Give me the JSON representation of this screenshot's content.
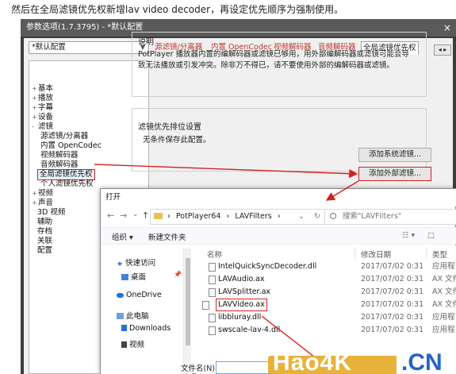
{
  "caption": "然后在全局滤镜优先权新增lav video decoder，再设定优先顺序为强制使用。",
  "settings": {
    "title": "参数选项(1.7.3795) - *默认配置",
    "close_glyph": "×",
    "preset": "*默认配置",
    "tabs": [
      "源滤镜/分离器",
      "内置 OpenCodec",
      "视频解码器",
      "音频解码器",
      "全局滤镜优先权"
    ],
    "tab_scroll": "◂ ▸",
    "tree": [
      {
        "label": "基本",
        "exp": "+"
      },
      {
        "label": "播放",
        "exp": "+"
      },
      {
        "label": "字幕",
        "exp": "+"
      },
      {
        "label": "设备",
        "exp": "+"
      },
      {
        "label": "滤镜",
        "exp": "-"
      },
      {
        "label": "源滤镜/分离器",
        "exp": ""
      },
      {
        "label": "内置 OpenCodec",
        "exp": ""
      },
      {
        "label": "视频解码器",
        "exp": ""
      },
      {
        "label": "音频解码器",
        "exp": ""
      },
      {
        "label": "全局滤镜优先权",
        "exp": ""
      },
      {
        "label": "个人滤镜优先权",
        "exp": ""
      },
      {
        "label": "视频",
        "exp": "+"
      },
      {
        "label": "声音",
        "exp": "+"
      },
      {
        "label": "3D 视频",
        "exp": ""
      },
      {
        "label": "辅助",
        "exp": ""
      },
      {
        "label": "存档",
        "exp": ""
      },
      {
        "label": "关联",
        "exp": ""
      },
      {
        "label": "配置",
        "exp": ""
      }
    ],
    "desc_title": "说明",
    "desc_text": "PotPlayer 播放器内置的编解码器或滤镜已够用，用外部编解码器或滤镜可能会导致无法播放或引发冲突。除非万不得已，请不要使用外部的编解码器或滤镜。",
    "priority_title": "滤镜优先排位设置",
    "priority_note": "无条件保存此配置。",
    "btn_add_system": "添加系统滤镜...",
    "btn_add_external": "添加外部滤镜..."
  },
  "dialog": {
    "title": "打开",
    "nav_back": "←",
    "nav_forward": "→",
    "nav_down": "⌄",
    "nav_up": "↑",
    "path_sep": "›",
    "path_end": "⌄",
    "refresh": "↻",
    "path": [
      "PotPlayer64",
      "LAVFilters"
    ],
    "search_placeholder": "搜索\"LAVFilters\"",
    "toolbar": {
      "organize": "组织 ▾",
      "new_folder": "新建文件夹",
      "view": "☷ ▾",
      "pane": "□"
    },
    "nav_items": [
      "快速访问",
      "桌面",
      "OneDrive",
      "此电脑",
      "Downloads",
      "视频"
    ],
    "pin": "📌",
    "columns": [
      "名称",
      "修改日期",
      "类型"
    ],
    "files": [
      {
        "name": "IntelQuickSyncDecoder.dll",
        "date": "2017/07/02 0:31",
        "type": "应用程"
      },
      {
        "name": "LAVAudio.ax",
        "date": "2017/07/02 0:31",
        "type": "AX 文件"
      },
      {
        "name": "LAVSplitter.ax",
        "date": "2017/07/02 0:31",
        "type": "AX 文件"
      },
      {
        "name": "LAVVideo.ax",
        "date": "2017/07/02 0:31",
        "type": "AX 文件"
      },
      {
        "name": "libbluray.dll",
        "date": "2017/07/02 0:31",
        "type": "应用程"
      },
      {
        "name": "swscale-lav-4.dll",
        "date": "2017/07/02 0:31",
        "type": "应用程"
      }
    ],
    "filename_label": "文件名(N):"
  },
  "watermark": {
    "text": "Hao4K",
    "suffix": ".CN"
  },
  "colors": {
    "highlight": "#d42020",
    "tab_red": "#c0392b",
    "onedrive": "#1e73d8",
    "watermark": "#e8b23a"
  }
}
